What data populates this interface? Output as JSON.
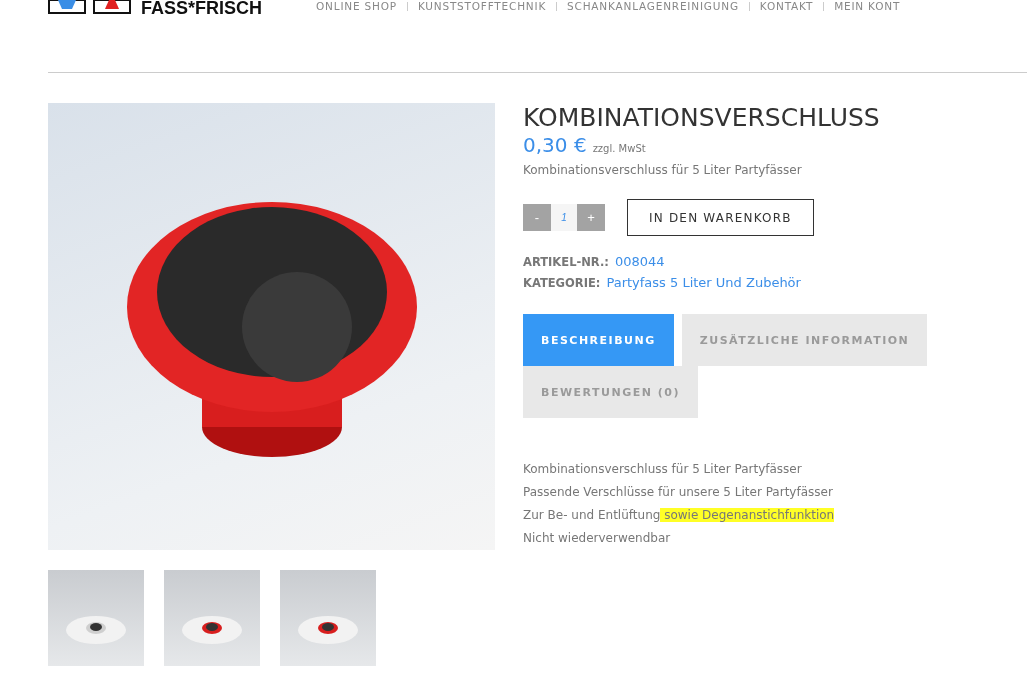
{
  "header": {
    "logo_text": "FASS*FRISCH",
    "nav": [
      "ONLINE SHOP",
      "KUNSTSTOFFTECHNIK",
      "SCHANKANLAGENREINIGUNG",
      "KONTAKT",
      "MEIN KONT"
    ]
  },
  "product": {
    "title": "KOMBINATIONSVERSCHLUSS",
    "price": "0,30 €",
    "tax_note": "zzgl. MwSt",
    "short_description": "Kombinationsverschluss für 5 Liter Partyfässer",
    "quantity": {
      "minus": "-",
      "value": "1",
      "plus": "+"
    },
    "add_to_cart": "IN DEN WARENKORB",
    "meta": [
      {
        "label": "ARTIKEL-NR.:",
        "value": "008044"
      },
      {
        "label": "KATEGORIE:",
        "value": "Partyfass 5 Liter Und Zubehör"
      }
    ]
  },
  "tabs": [
    {
      "label": "BESCHREIBUNG",
      "selected": true
    },
    {
      "label": "ZUSÄTZLICHE INFORMATION",
      "selected": false
    },
    {
      "label": "BEWERTUNGEN (0)",
      "selected": false
    }
  ],
  "description": [
    [
      {
        "text": "Kombinationsverschluss für 5 Liter Partyfässer",
        "highlighted": false
      }
    ],
    [
      {
        "text": "Passende Verschlüsse für unsere 5 Liter Partyfässer",
        "highlighted": false
      }
    ],
    [
      {
        "text": "Zur Be- und Entlüftung",
        "highlighted": false
      },
      {
        "text": " sowie Degenanstichfunktion ",
        "highlighted": true
      }
    ],
    [
      {
        "text": "Nicht wiederverwendbar",
        "highlighted": false
      }
    ]
  ],
  "thumbnails": [
    {
      "kind": "plain"
    },
    {
      "kind": "red"
    },
    {
      "kind": "red"
    }
  ]
}
